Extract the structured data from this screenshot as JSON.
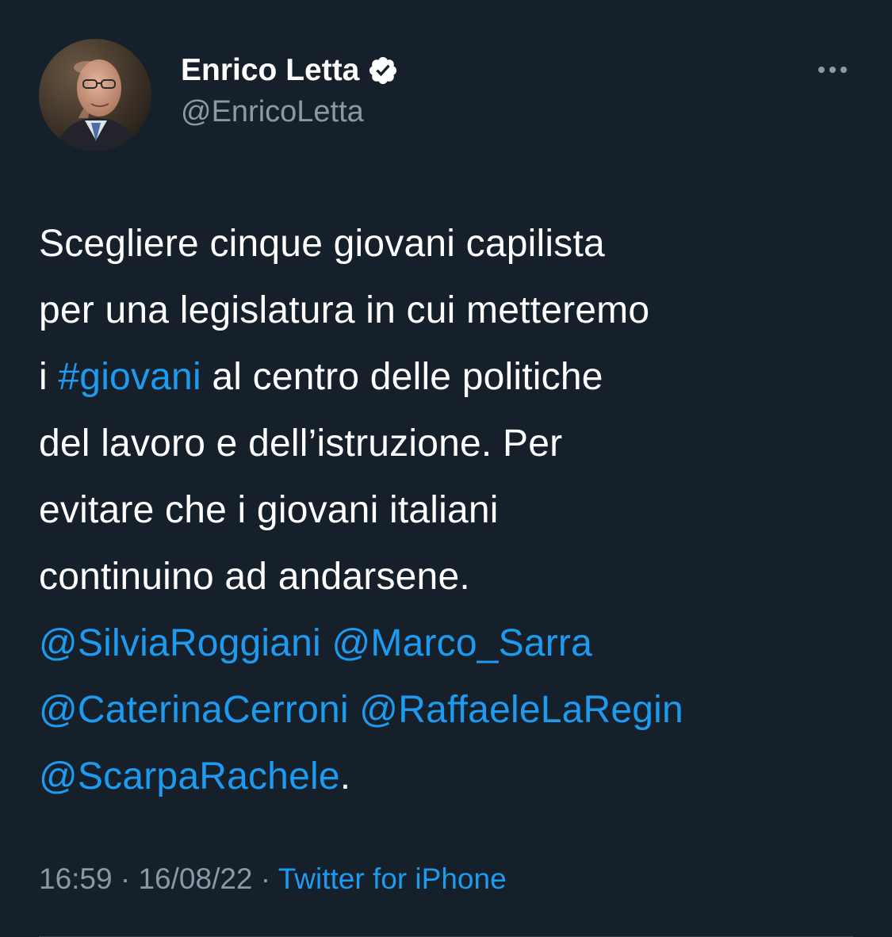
{
  "author": {
    "display_name": "Enrico Letta",
    "handle": "@EnricoLetta"
  },
  "icons": {
    "verified": "verified-badge-icon",
    "more": "more-options-icon"
  },
  "tweet": {
    "lines": [
      [
        {
          "text": "Scegliere cinque giovani capilista",
          "link": false
        }
      ],
      [
        {
          "text": "per una legislatura in cui metteremo",
          "link": false
        }
      ],
      [
        {
          "text": "i ",
          "link": false
        },
        {
          "text": "#giovani",
          "link": true
        },
        {
          "text": " al centro delle politiche",
          "link": false
        }
      ],
      [
        {
          "text": "del lavoro e dell’istruzione. Per",
          "link": false
        }
      ],
      [
        {
          "text": "evitare che i giovani italiani",
          "link": false
        }
      ],
      [
        {
          "text": "continuino ad andarsene.",
          "link": false
        }
      ],
      [
        {
          "text": "@SilviaRoggiani",
          "link": true
        },
        {
          "text": " ",
          "link": false
        },
        {
          "text": "@Marco_Sarra",
          "link": true
        }
      ],
      [
        {
          "text": "@CaterinaCerroni",
          "link": true
        },
        {
          "text": " ",
          "link": false
        },
        {
          "text": "@RaffaeleLaRegin",
          "link": true
        }
      ],
      [
        {
          "text": "@ScarpaRachele",
          "link": true
        },
        {
          "text": ".",
          "link": false
        }
      ]
    ]
  },
  "meta": {
    "time": "16:59",
    "separator1": " · ",
    "date": "16/08/22",
    "separator2": " · ",
    "source": "Twitter for iPhone"
  },
  "colors": {
    "background": "#15202b",
    "link": "#1d9bf0",
    "secondary_text": "#8b98a5"
  }
}
